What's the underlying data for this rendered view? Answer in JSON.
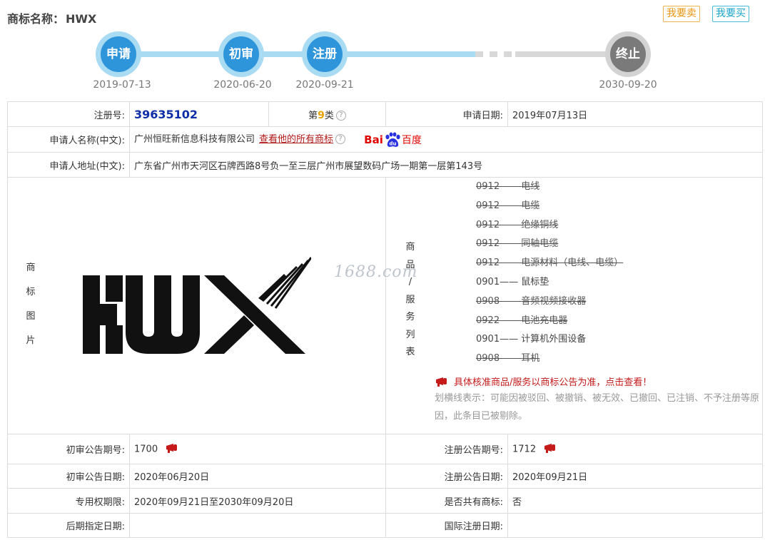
{
  "header": {
    "label": "商标名称：",
    "name": "HWX",
    "sell_label": "我要卖",
    "buy_label": "我要买"
  },
  "timeline": {
    "steps": [
      {
        "label": "申请",
        "date": "2019-07-13"
      },
      {
        "label": "初审",
        "date": "2020-06-20"
      },
      {
        "label": "注册",
        "date": "2020-09-21"
      },
      {
        "label": "终止",
        "date": "2030-09-20"
      }
    ]
  },
  "details": {
    "reg_no_label": "注册号:",
    "reg_no": "39635102",
    "class_prefix": "第",
    "class_no": "9",
    "class_suffix": "类",
    "apply_date_label": "申请日期:",
    "apply_date": "2019年07月13日",
    "applicant_label": "申请人名称(中文):",
    "applicant": "广州恒旺新信息科技有限公司",
    "all_marks_link": "查看他的所有商标",
    "baidu_prefix": "Bai",
    "baidu_suffix": "百度",
    "address_label": "申请人地址(中文):",
    "address": "广东省广州市天河区石牌西路8号负一至三层广州市展望数码广场一期第一层第143号",
    "image_label": [
      "商",
      "标",
      "图",
      "片"
    ],
    "goods_label": [
      "商",
      "品",
      "/",
      "服",
      "务",
      "列",
      "表"
    ],
    "goods": [
      {
        "code": "0912",
        "name": "电线",
        "struck": true
      },
      {
        "code": "0912",
        "name": "电缆",
        "struck": true
      },
      {
        "code": "0912",
        "name": "绝缘铜线",
        "struck": true
      },
      {
        "code": "0912",
        "name": "同轴电缆",
        "struck": true
      },
      {
        "code": "0912",
        "name": "电源材料（电线、电缆）",
        "struck": true
      },
      {
        "code": "0901",
        "name": "鼠标垫",
        "struck": false
      },
      {
        "code": "0908",
        "name": "音频视频接收器",
        "struck": true
      },
      {
        "code": "0922",
        "name": "电池充电器",
        "struck": true
      },
      {
        "code": "0901",
        "name": "计算机外围设备",
        "struck": false
      },
      {
        "code": "0908",
        "name": "耳机",
        "struck": true
      }
    ],
    "goods_notice": "具体核准商品/服务以商标公告为准，点击查看！",
    "strike_hint": "划横线表示：可能因被驳回、被撤销、被无效、已撤回、已注销、不予注册等原因，此条目已被剔除。",
    "watermark": "1688.com",
    "prelim_no_label": "初审公告期号:",
    "prelim_no": "1700",
    "reg_ann_no_label": "注册公告期号:",
    "reg_ann_no": "1712",
    "prelim_date_label": "初审公告日期:",
    "prelim_date": "2020年06月20日",
    "reg_ann_date_label": "注册公告日期:",
    "reg_ann_date": "2020年09月21日",
    "exclusive_label": "专用权期限:",
    "exclusive": "2020年09月21日至2030年09月20日",
    "shared_label": "是否共有商标:",
    "shared": "否",
    "later_label": "后期指定日期:",
    "later": "",
    "intl_label": "国际注册日期:",
    "intl": ""
  },
  "colors": {
    "timeline_active": "#2f95da",
    "timeline_track": "#a9dbf3",
    "timeline_end": "#7a7a7a",
    "reg_no": "#0f2fa8",
    "class_no": "#e8a100",
    "link": "#b21818",
    "baidu": "#e10601"
  }
}
